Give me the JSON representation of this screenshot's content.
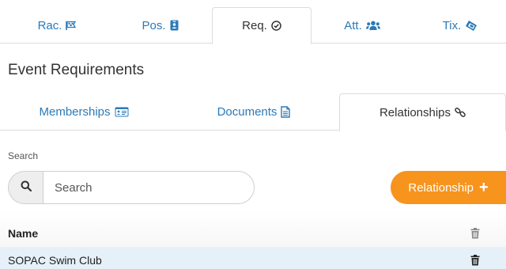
{
  "top_tabs": [
    {
      "label": "Rac.",
      "icon": "flag-checkered-icon"
    },
    {
      "label": "Pos.",
      "icon": "id-badge-icon"
    },
    {
      "label": "Req.",
      "icon": "check-circle-icon"
    },
    {
      "label": "Att.",
      "icon": "users-icon"
    },
    {
      "label": "Tix.",
      "icon": "ticket-icon"
    }
  ],
  "active_top_tab": "Req.",
  "section_title": "Event Requirements",
  "inner_tabs": [
    {
      "label": "Memberships",
      "icon": "id-card-icon"
    },
    {
      "label": "Documents",
      "icon": "file-text-icon"
    },
    {
      "label": "Relationships",
      "icon": "link-icon"
    }
  ],
  "active_inner_tab": "Relationships",
  "search": {
    "label": "Search",
    "placeholder": "Search",
    "value": ""
  },
  "add_button": {
    "label": "Relationship",
    "icon": "plus-icon"
  },
  "table": {
    "header": "Name",
    "rows": [
      {
        "name": "SOPAC Swim Club"
      }
    ]
  },
  "colors": {
    "link": "#2a7ab8",
    "accent": "#f7941d",
    "row_highlight": "#e5f0f8"
  }
}
